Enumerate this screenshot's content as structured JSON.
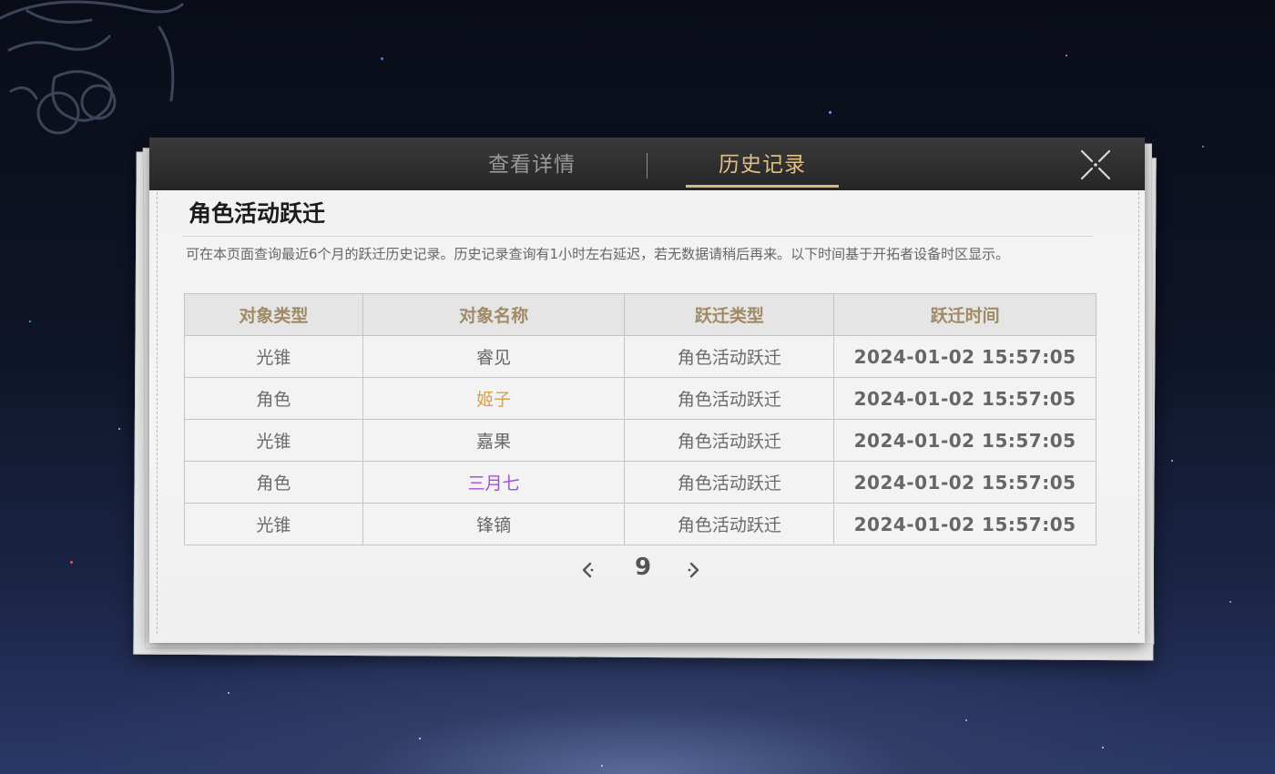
{
  "tabs": [
    {
      "label": "查看详情",
      "active": false
    },
    {
      "label": "历史记录",
      "active": true
    }
  ],
  "section": {
    "title": "角色活动跃迁",
    "description": "可在本页面查询最近6个月的跃迁历史记录。历史记录查询有1小时左右延迟，若无数据请稍后再来。以下时间基于开拓者设备时区显示。"
  },
  "table": {
    "headers": [
      "对象类型",
      "对象名称",
      "跃迁类型",
      "跃迁时间"
    ],
    "rows": [
      {
        "type": "光锥",
        "name": "睿见",
        "name_color": "#666666",
        "warp": "角色活动跃迁",
        "time": "2024-01-02 15:57:05"
      },
      {
        "type": "角色",
        "name": "姬子",
        "name_color": "#d8a04c",
        "warp": "角色活动跃迁",
        "time": "2024-01-02 15:57:05"
      },
      {
        "type": "光锥",
        "name": "嘉果",
        "name_color": "#666666",
        "warp": "角色活动跃迁",
        "time": "2024-01-02 15:57:05"
      },
      {
        "type": "角色",
        "name": "三月七",
        "name_color": "#a24fd8",
        "warp": "角色活动跃迁",
        "time": "2024-01-02 15:57:05"
      },
      {
        "type": "光锥",
        "name": "锋镝",
        "name_color": "#666666",
        "warp": "角色活动跃迁",
        "time": "2024-01-02 15:57:05"
      }
    ]
  },
  "pager": {
    "page": "9"
  },
  "icons": {
    "close": "close-icon",
    "prev": "chevron-left-icon",
    "next": "chevron-right-icon"
  },
  "colors": {
    "accent": "#d9b87c",
    "header_text": "#a08a66",
    "tabbar": "#2d2d2d"
  }
}
